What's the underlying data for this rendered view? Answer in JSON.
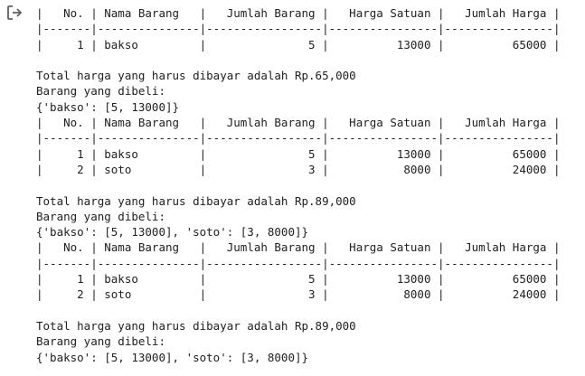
{
  "output_lines": [
    "|   No. | Nama Barang   |   Jumlah Barang |   Harga Satuan |   Jumlah Harga |",
    "|-------|---------------|-----------------|----------------|----------------|",
    "|     1 | bakso         |               5 |          13000 |          65000 |",
    "",
    "Total harga yang harus dibayar adalah Rp.65,000",
    "Barang yang dibeli:",
    "{'bakso': [5, 13000]}",
    "|   No. | Nama Barang   |   Jumlah Barang |   Harga Satuan |   Jumlah Harga |",
    "|-------|---------------|-----------------|----------------|----------------|",
    "|     1 | bakso         |               5 |          13000 |          65000 |",
    "|     2 | soto          |               3 |           8000 |          24000 |",
    "",
    "Total harga yang harus dibayar adalah Rp.89,000",
    "Barang yang dibeli:",
    "{'bakso': [5, 13000], 'soto': [3, 8000]}",
    "|   No. | Nama Barang   |   Jumlah Barang |   Harga Satuan |   Jumlah Harga |",
    "|-------|---------------|-----------------|----------------|----------------|",
    "|     1 | bakso         |               5 |          13000 |          65000 |",
    "|     2 | soto          |               3 |           8000 |          24000 |",
    "",
    "Total harga yang harus dibayar adalah Rp.89,000",
    "Barang yang dibeli:",
    "{'bakso': [5, 13000], 'soto': [3, 8000]}"
  ],
  "icons": {
    "output_toggle": "output-redirect-icon"
  },
  "colors": {
    "text": "#212121",
    "icon": "#616161",
    "background": "#ffffff"
  }
}
